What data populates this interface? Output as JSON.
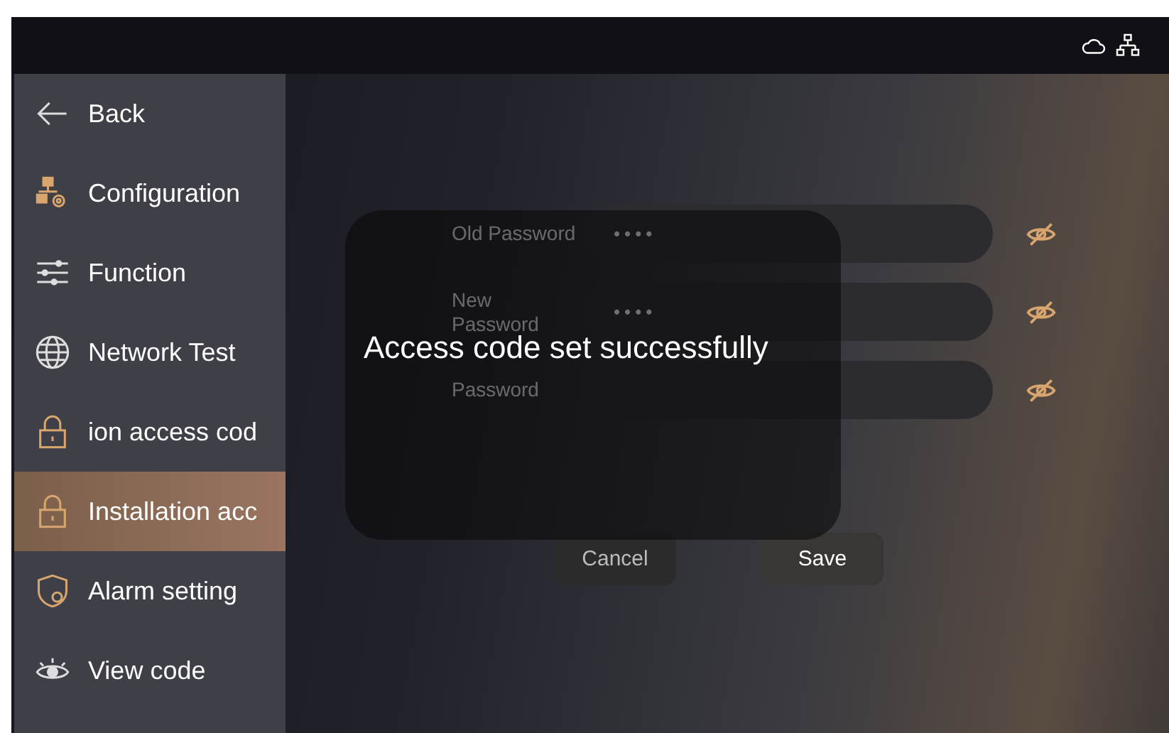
{
  "sidebar": {
    "items": [
      {
        "kind": "back",
        "label": "Back",
        "selected": false
      },
      {
        "kind": "config",
        "label": "Configuration",
        "selected": false
      },
      {
        "kind": "sliders",
        "label": "Function",
        "selected": false
      },
      {
        "kind": "globe",
        "label": "Network Test",
        "selected": false
      },
      {
        "kind": "lock",
        "label": "ion access cod",
        "selected": false
      },
      {
        "kind": "lock",
        "label": "Installation acc",
        "selected": true
      },
      {
        "kind": "shield",
        "label": "Alarm setting",
        "selected": false
      },
      {
        "kind": "eye",
        "label": "View code",
        "selected": false
      }
    ]
  },
  "form": {
    "fields": [
      {
        "label": "Old Password",
        "value": "••••"
      },
      {
        "label": "New Password",
        "value": "••••"
      },
      {
        "label": "Password"
      }
    ],
    "buttons": [
      {
        "kind": "cancel",
        "label": "Cancel"
      },
      {
        "kind": "save",
        "label": "Save"
      }
    ]
  },
  "toast": {
    "message": "Access code set successfully"
  }
}
